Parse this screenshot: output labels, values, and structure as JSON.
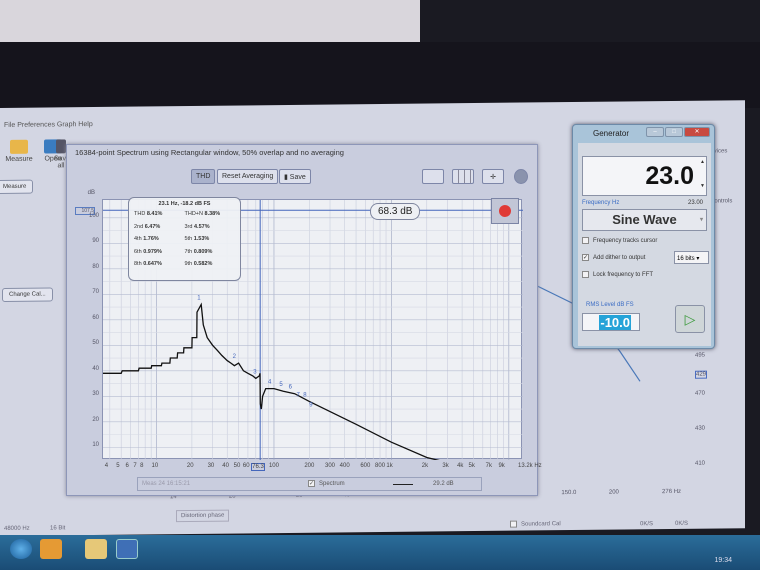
{
  "background_app": {
    "menu": "File  Preferences  Graph  Help",
    "toolbar": [
      "Measure",
      "Open",
      "Save all"
    ],
    "measure_button": "Measure",
    "change_cal_button": "Change Cal...",
    "right_labels": [
      "Devices",
      "Controls"
    ],
    "axis_x_ticks": [
      "14",
      "20",
      "30",
      "40",
      "50",
      "60",
      "70",
      "80",
      "90",
      "100",
      "150.0",
      "200",
      "276 Hz"
    ],
    "axis_y_ticks": [
      "495",
      "429",
      "470",
      "430",
      "410"
    ],
    "status": [
      "48000 Hz",
      "16 Bit",
      "0K/S",
      "0K/S"
    ],
    "legend": [
      "Distortion phase",
      "Soundcard Cal"
    ]
  },
  "spectrum": {
    "title": "16384-point Spectrum using Rectangular window, 50% overlap and no averaging",
    "buttons": {
      "thd": "THD",
      "reset": "Reset Averaging",
      "save": "Save"
    },
    "y_unit": "dB",
    "y_marker": "107.5",
    "y_ticks": [
      "100",
      "90",
      "80",
      "70",
      "60",
      "50",
      "40",
      "30",
      "20",
      "10"
    ],
    "x_ticks": [
      "4",
      "5",
      "6",
      "7",
      "8",
      "10",
      "20",
      "30",
      "40",
      "50",
      "60",
      "100",
      "200",
      "300",
      "400",
      "600",
      "800",
      "1k",
      "2k",
      "3k",
      "4k",
      "5k",
      "7k",
      "9k",
      "13.2k Hz"
    ],
    "x_cursor": "76.3",
    "cursor_readout": "68.3 dB",
    "thd_panel": {
      "header": "23.1 Hz, -18.2 dB FS",
      "rows": [
        [
          [
            "THD",
            "8.41%"
          ],
          [
            "THD+N",
            "8.38%"
          ]
        ],
        [
          [
            "2nd",
            "6.47%"
          ],
          [
            "3rd",
            "4.57%"
          ]
        ],
        [
          [
            "4th",
            "1.76%"
          ],
          [
            "5th",
            "1.53%"
          ]
        ],
        [
          [
            "6th",
            "0.979%"
          ],
          [
            "7th",
            "0.809%"
          ]
        ],
        [
          [
            "8th",
            "0.647%"
          ],
          [
            "9th",
            "0.582%"
          ]
        ]
      ]
    },
    "legend": {
      "meas": "Meas 24 16:15:21",
      "check": "Spectrum",
      "value": "29.2 dB"
    },
    "chart_data": {
      "type": "line",
      "xscale": "log",
      "xlim": [
        3.5,
        13200
      ],
      "ylim": [
        5,
        107
      ],
      "ylabel": "dB",
      "harmonic_labels": [
        "1",
        "2",
        "3",
        "4",
        "5",
        "6",
        "7",
        "8",
        "9"
      ],
      "x": [
        3.5,
        5,
        5.1,
        7,
        7.1,
        9,
        9.1,
        11,
        11.1,
        13,
        13.1,
        15,
        15.1,
        17,
        17.1,
        20,
        20.1,
        22,
        22.1,
        24,
        25,
        27,
        30,
        33,
        36,
        40,
        43,
        46,
        50,
        55,
        60,
        66,
        70,
        75,
        76,
        76.5,
        78,
        80,
        85,
        100,
        120,
        150,
        200,
        300,
        500,
        1000,
        2000,
        3000
      ],
      "y": [
        39,
        39,
        40,
        40,
        41,
        41,
        42,
        42,
        43,
        43,
        45,
        45,
        47,
        47,
        49,
        49,
        53,
        53,
        63,
        66,
        58,
        53,
        50,
        48,
        46,
        44,
        43,
        42,
        43,
        40,
        39,
        38,
        37,
        38,
        39,
        27,
        25,
        30,
        33,
        33,
        32,
        31,
        28,
        24,
        19,
        12,
        6,
        4
      ]
    }
  },
  "generator": {
    "title": "Generator",
    "frequency": "23.0",
    "frequency_label": "Frequency Hz",
    "frequency_value": "23.00",
    "waveform": "Sine Wave",
    "options": [
      {
        "label": "Frequency tracks cursor",
        "checked": false
      },
      {
        "label": "Add dither to output",
        "checked": true
      },
      {
        "label": "Lock frequency to FFT",
        "checked": false
      }
    ],
    "bits": "16 bits",
    "level_label": "RMS Level dB FS",
    "level": "-10.0"
  },
  "taskbar": {
    "clock": "19:34"
  }
}
